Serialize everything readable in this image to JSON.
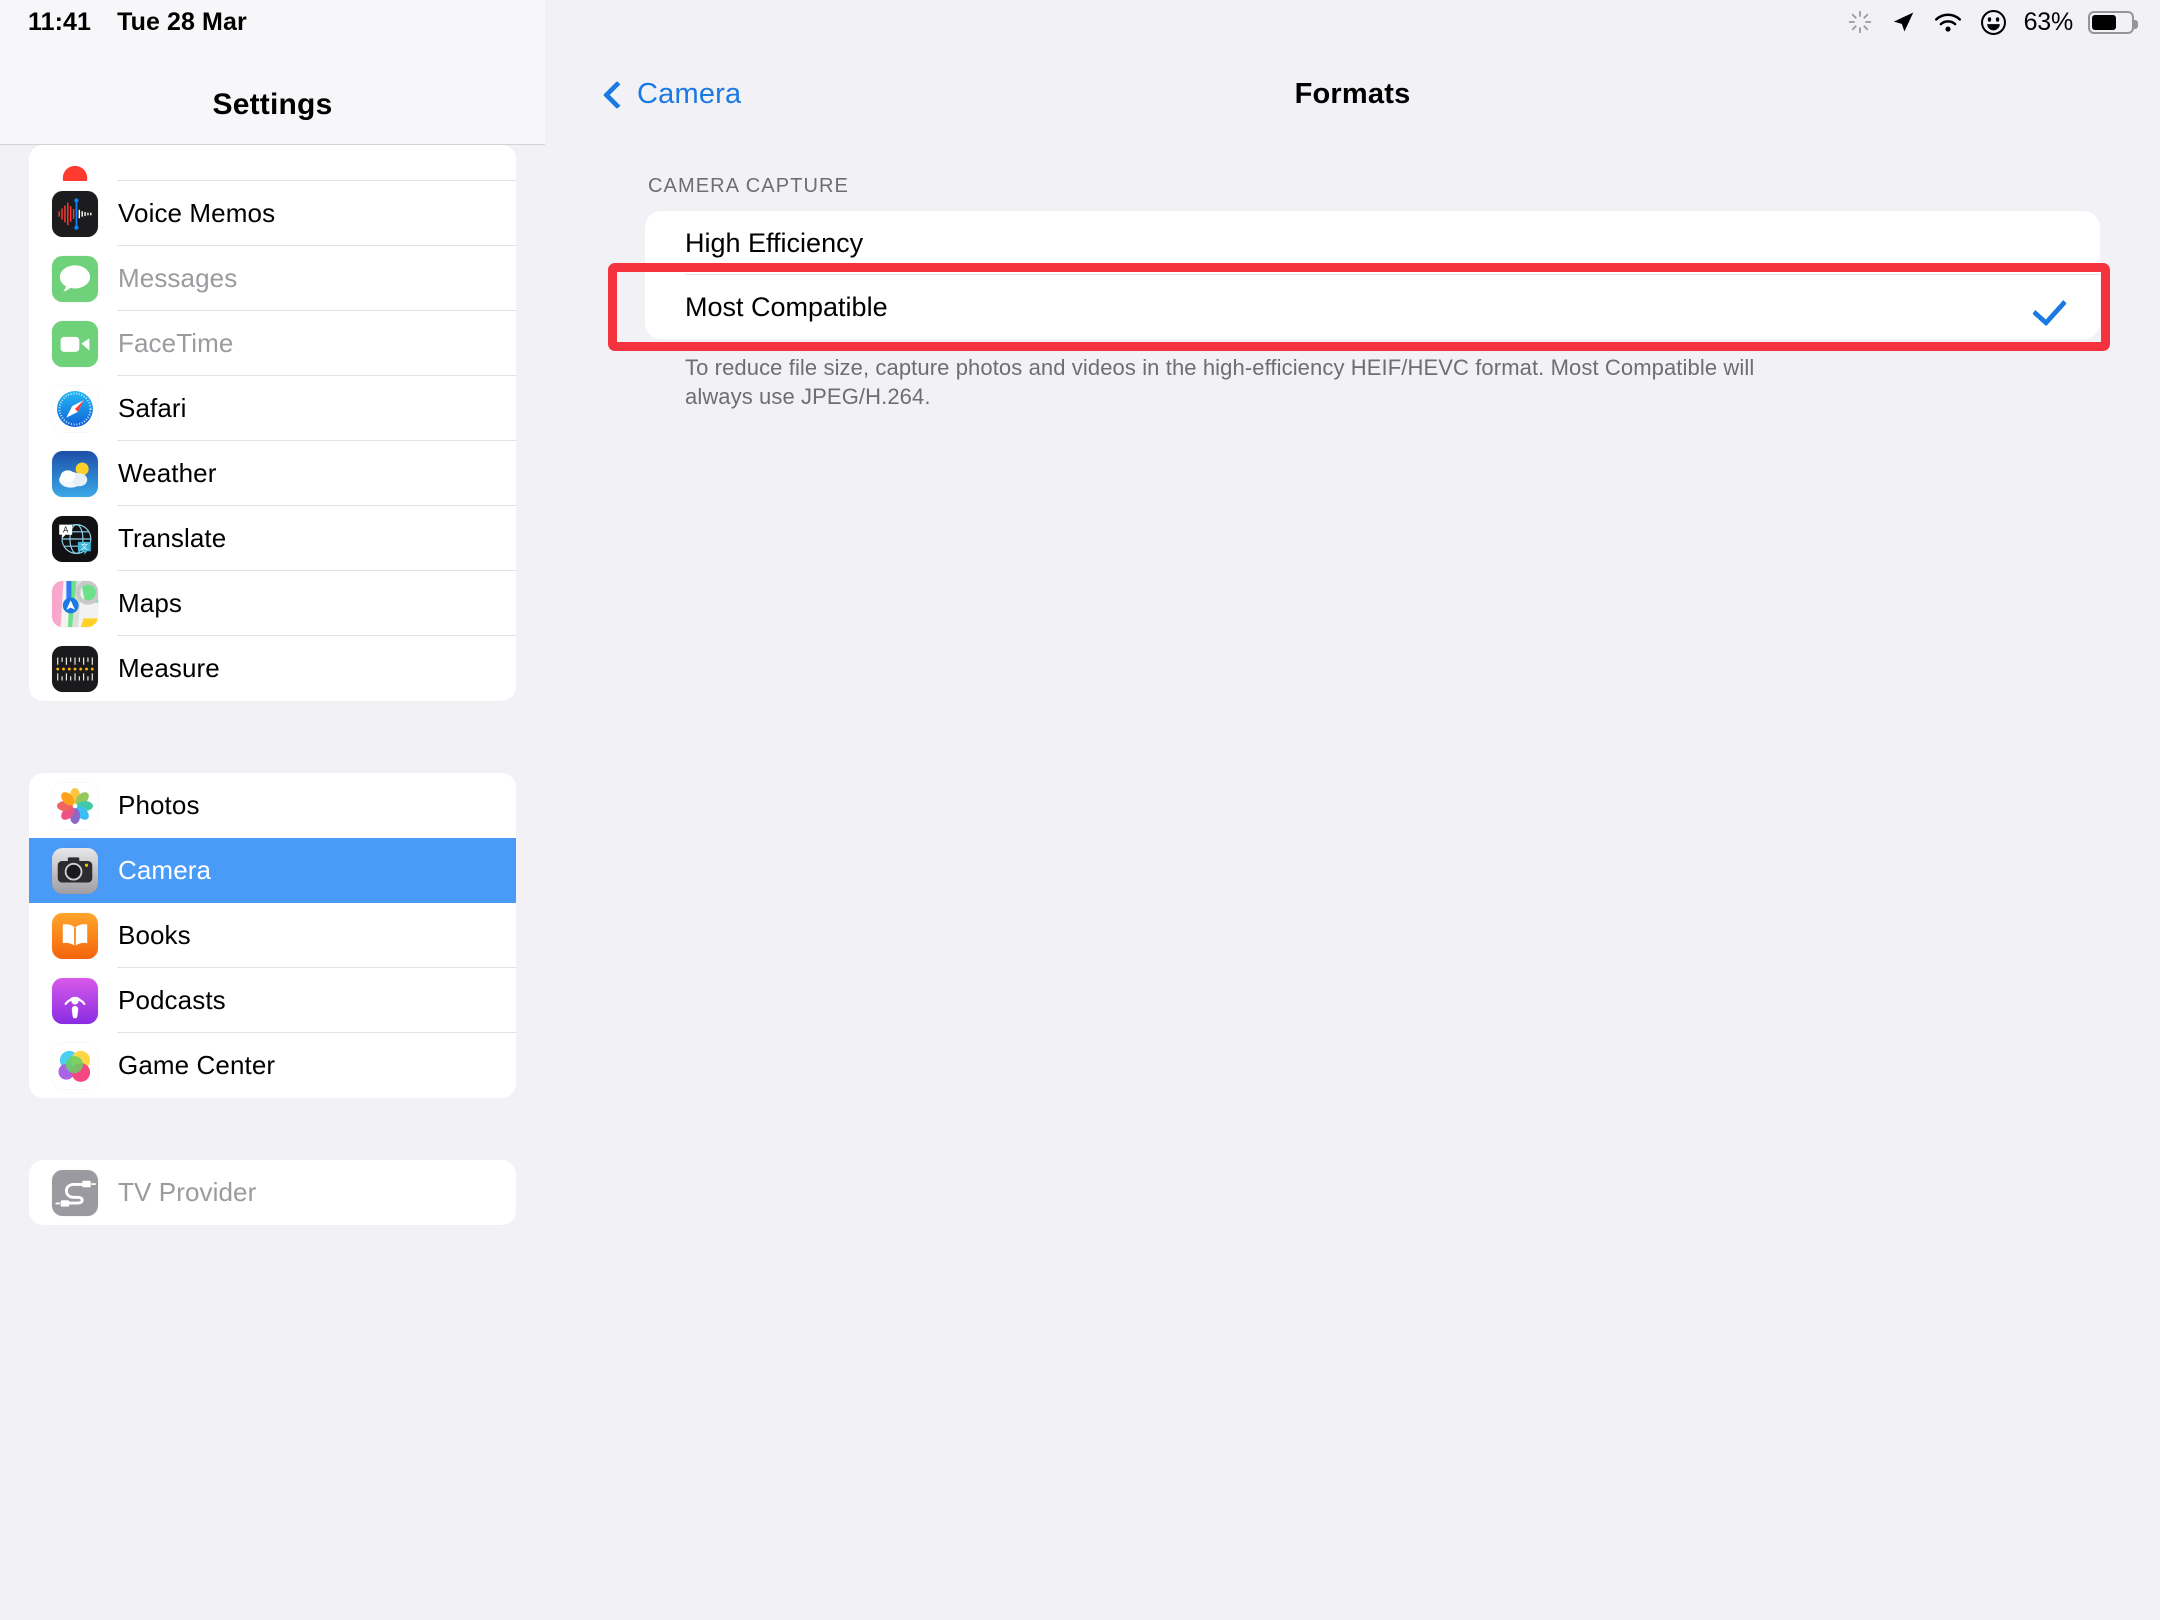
{
  "status_bar": {
    "time": "11:41",
    "date": "Tue 28 Mar",
    "battery_percent": "63%",
    "battery_level": 63,
    "icons": [
      "spinner-icon",
      "location-arrow-icon",
      "wifi-icon",
      "smiley-face-icon",
      "battery-icon"
    ]
  },
  "sidebar": {
    "title": "Settings",
    "groups": [
      {
        "partial_top": true,
        "items": [
          {
            "label": "Voice Memos",
            "icon": "voice-memos-icon",
            "dim": false,
            "selected": false
          },
          {
            "label": "Messages",
            "icon": "messages-icon",
            "dim": true,
            "selected": false
          },
          {
            "label": "FaceTime",
            "icon": "facetime-icon",
            "dim": true,
            "selected": false
          },
          {
            "label": "Safari",
            "icon": "safari-icon",
            "dim": false,
            "selected": false
          },
          {
            "label": "Weather",
            "icon": "weather-icon",
            "dim": false,
            "selected": false
          },
          {
            "label": "Translate",
            "icon": "translate-icon",
            "dim": false,
            "selected": false
          },
          {
            "label": "Maps",
            "icon": "maps-icon",
            "dim": false,
            "selected": false
          },
          {
            "label": "Measure",
            "icon": "measure-icon",
            "dim": false,
            "selected": false
          }
        ]
      },
      {
        "partial_top": false,
        "items": [
          {
            "label": "Photos",
            "icon": "photos-icon",
            "dim": false,
            "selected": false
          },
          {
            "label": "Camera",
            "icon": "camera-icon",
            "dim": false,
            "selected": true
          },
          {
            "label": "Books",
            "icon": "books-icon",
            "dim": false,
            "selected": false
          },
          {
            "label": "Podcasts",
            "icon": "podcasts-icon",
            "dim": false,
            "selected": false
          },
          {
            "label": "Game Center",
            "icon": "game-center-icon",
            "dim": false,
            "selected": false
          }
        ]
      },
      {
        "partial_top": false,
        "items": [
          {
            "label": "TV Provider",
            "icon": "tv-provider-icon",
            "dim": true,
            "selected": false
          }
        ]
      }
    ]
  },
  "detail": {
    "back_label": "Camera",
    "title": "Formats",
    "section_header": "CAMERA CAPTURE",
    "options": [
      {
        "label": "High Efficiency",
        "checked": false
      },
      {
        "label": "Most Compatible",
        "checked": true
      }
    ],
    "footnote": "To reduce file size, capture photos and videos in the high-efficiency HEIF/HEVC format. Most Compatible will always use JPEG/H.264."
  },
  "annotation": {
    "highlight_color": "#f5333f",
    "highlight_target": "Most Compatible"
  },
  "colors": {
    "accent_blue": "#1a79e3",
    "selected_row_blue": "#4a9bf7",
    "page_background": "#f1f1f6",
    "card_background": "#ffffff",
    "secondary_text": "#6d6d72"
  }
}
